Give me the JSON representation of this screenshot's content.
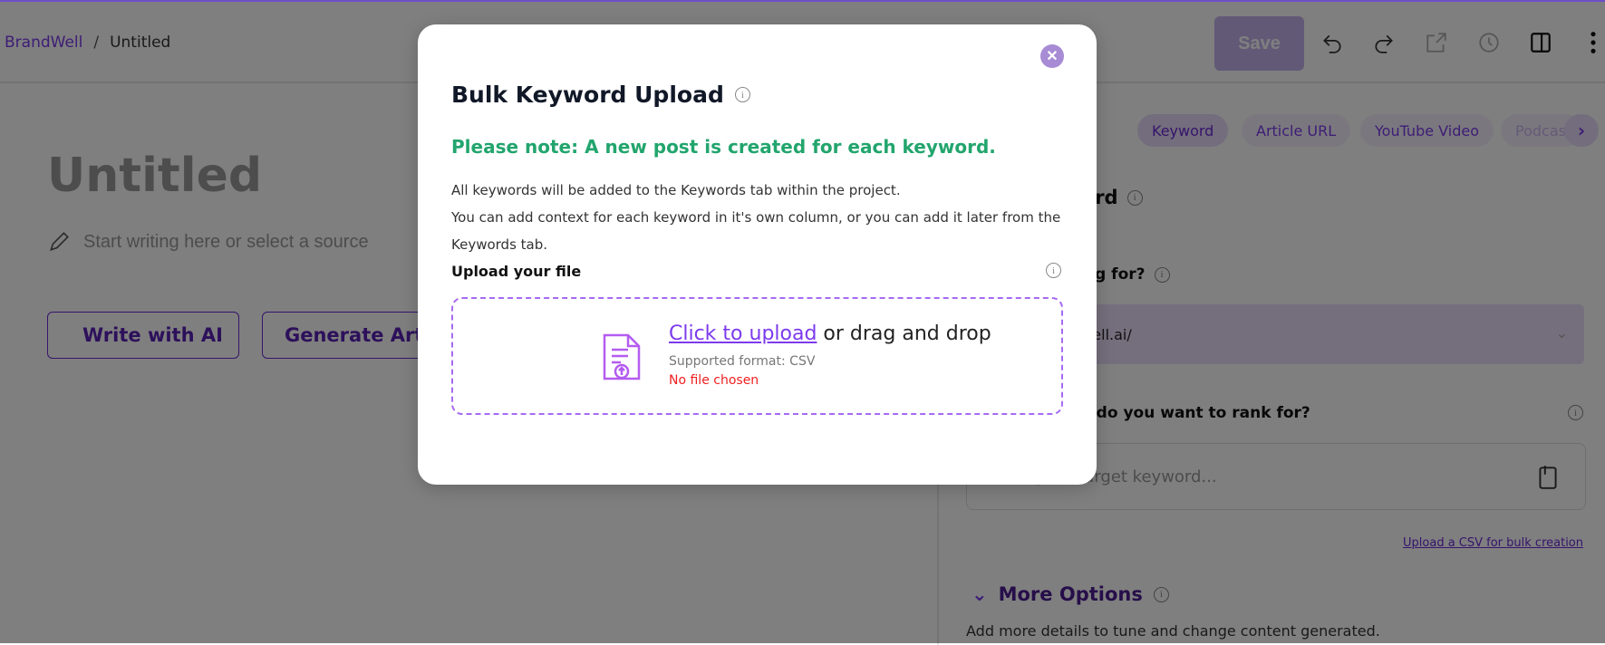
{
  "header": {
    "breadcrumb": {
      "brand": "BrandWell",
      "separator": "/",
      "page": "Untitled"
    },
    "save_label": "Save",
    "icons": [
      "undo-icon",
      "redo-icon",
      "external-link-icon",
      "history-icon",
      "panel-toggle-icon",
      "more-vertical-icon"
    ]
  },
  "editor": {
    "title": "Untitled",
    "prompt": "Start writing here or select a source",
    "write_ai_label": "Write with AI",
    "generate_label": "Generate Article"
  },
  "right_panel": {
    "source_tabs": [
      {
        "label": "",
        "active": true
      },
      {
        "label": "Keyword",
        "active": true
      },
      {
        "label": "Article URL",
        "active": false
      },
      {
        "label": "YouTube Video",
        "active": false
      },
      {
        "label": "Podcast",
        "active": false
      }
    ],
    "section_title": "Main Keyword",
    "site_question": "Who is this blog for?",
    "site_value": "https://brandwell.ai/",
    "rank_question": "What keyword do you want to rank for?",
    "keyword_placeholder": "Enter your target keyword...",
    "csv_link": "Upload a CSV for bulk creation",
    "more_options": "More Options",
    "more_options_desc": "Add more details to tune and change content generated."
  },
  "modal": {
    "title": "Bulk Keyword Upload",
    "note": "Please note: A new post is created for each keyword.",
    "desc1": "All keywords will be added to the Keywords tab within the project.",
    "desc2": "You can add context for each keyword in it's own column, or you can add it later from the Keywords tab.",
    "upload_label": "Upload your file",
    "click_upload": "Click to upload",
    "drag_text": " or drag and drop",
    "supported": "Supported format: CSV",
    "no_file": "No file chosen",
    "colors": {
      "accent": "#7c3aed",
      "note": "#22a56d",
      "error": "#ef1f1f"
    }
  }
}
